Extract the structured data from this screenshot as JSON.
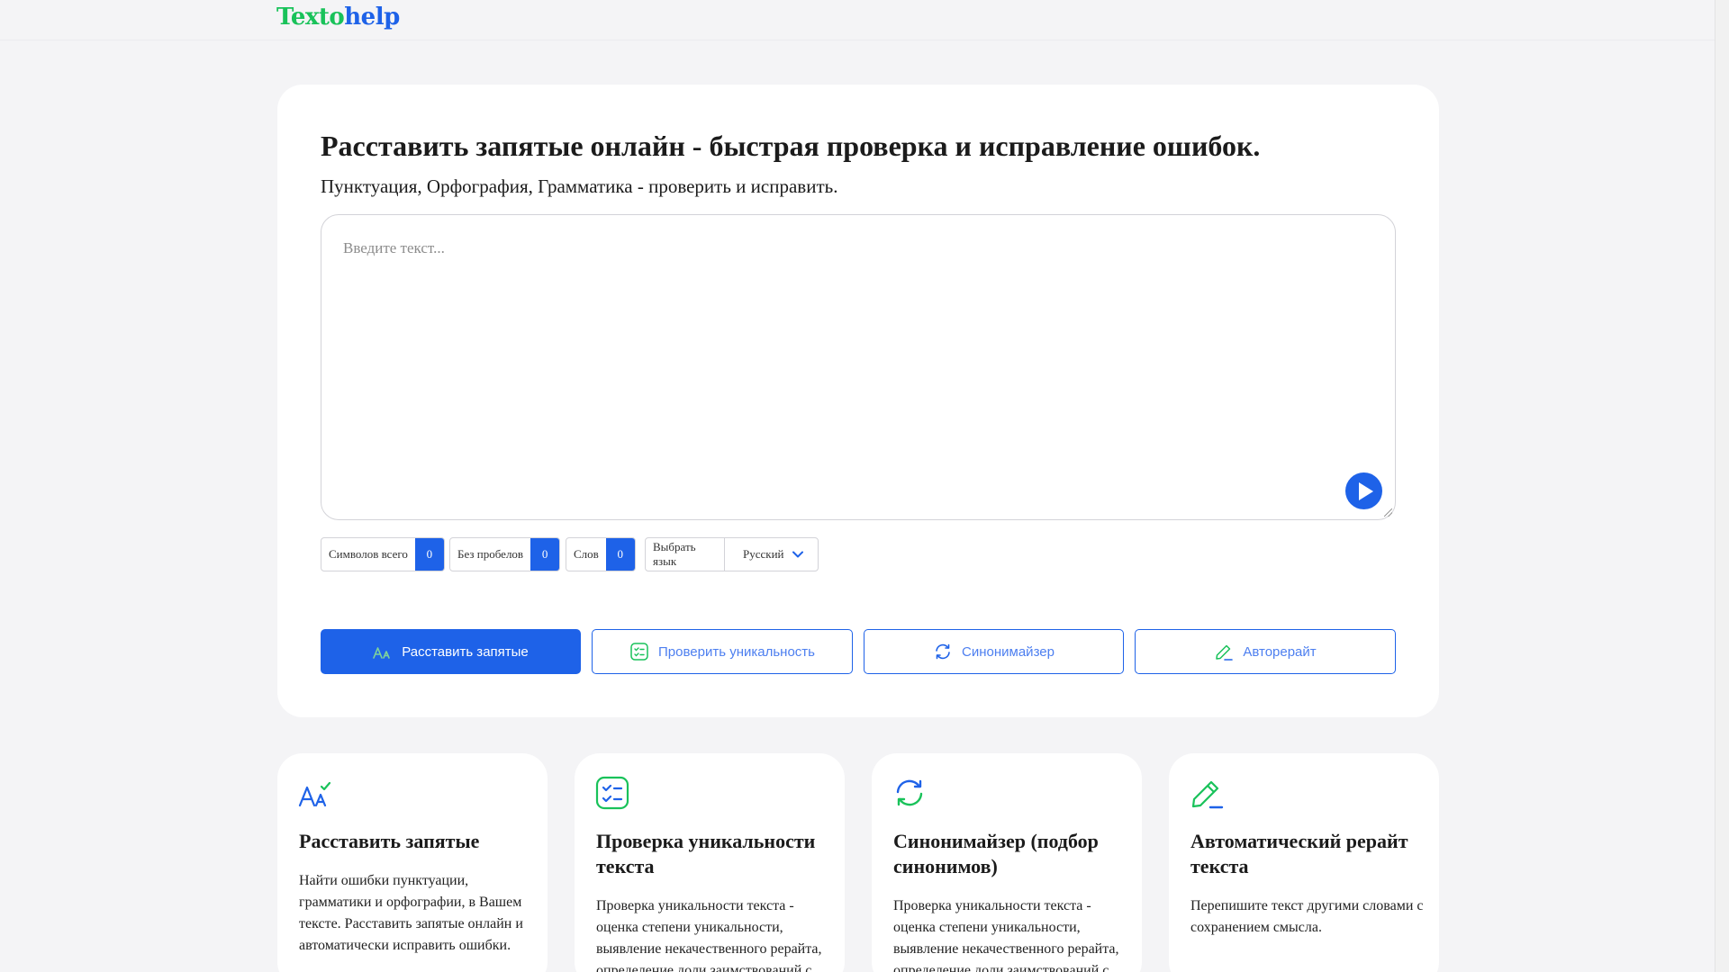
{
  "header": {
    "logo_part1": "Texto",
    "logo_part2": "help"
  },
  "main": {
    "title": "Расставить запятые онлайн - быстрая проверка и исправление ошибок.",
    "subtitle": "Пунктуация, Орфография, Грамматика - проверить и исправить.",
    "textarea_placeholder": "Введите текст...",
    "stats": {
      "chars_label": "Символов всего",
      "chars_value": "0",
      "nospace_label": "Без пробелов",
      "nospace_value": "0",
      "words_label": "Слов",
      "words_value": "0"
    },
    "language": {
      "label": "Выбрать язык",
      "selected": "Русский"
    },
    "buttons": {
      "commas": "Расставить запятые",
      "unique": "Проверить уникальность",
      "synonym": "Синонимайзер",
      "rewrite": "Авторерайт"
    }
  },
  "features": [
    {
      "title": "Расставить запятые",
      "desc": "Найти ошибки пунктуации, грамматики и орфографии, в Вашем тексте. Расставить запятые онлайн и автоматически исправить ошибки."
    },
    {
      "title": "Проверка уникальности текста",
      "desc": "Проверка уникальности текста - оценка степени уникальности, выявление некачественного рерайта, определение доли заимствований с"
    },
    {
      "title": "Синонимайзер (подбор синонимов)",
      "desc": "Проверка уникальности текста - оценка степени уникальности, выявление некачественного рерайта, определение доли заимствований с"
    },
    {
      "title": "Автоматический рерайт текста",
      "desc": "Перепишите текст другими словами с сохранением смысла."
    }
  ],
  "colors": {
    "accent": "#1e62e8",
    "green": "#19c25a",
    "background": "#f4f4f6"
  }
}
